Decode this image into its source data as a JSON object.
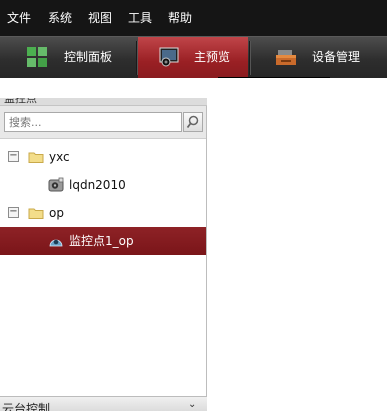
{
  "menu": {
    "items": [
      "文件",
      "系统",
      "视图",
      "工具",
      "帮助"
    ]
  },
  "toolbar": {
    "buttons": [
      {
        "label": "控制面板",
        "icon": "grid-icon"
      },
      {
        "label": "主预览",
        "icon": "monitor-camera-icon",
        "active": true
      },
      {
        "label": "设备管理",
        "icon": "device-box-icon"
      }
    ]
  },
  "panel": {
    "title": "监控点",
    "search_placeholder": "搜索...",
    "tree": [
      {
        "label": "yxc",
        "type": "folder",
        "expanded": true,
        "expander": "−"
      },
      {
        "label": "lqdn2010",
        "type": "device"
      },
      {
        "label": "op",
        "type": "folder",
        "expanded": true,
        "expander": "−"
      },
      {
        "label": "监控点1_op",
        "type": "camera",
        "selected": true
      }
    ],
    "bottom_label": "云台控制",
    "bottom_chevron": "⌄"
  },
  "colors": {
    "active_red": "#9a2024",
    "selected_row": "#7e181c",
    "menubar_bg": "#151515"
  }
}
